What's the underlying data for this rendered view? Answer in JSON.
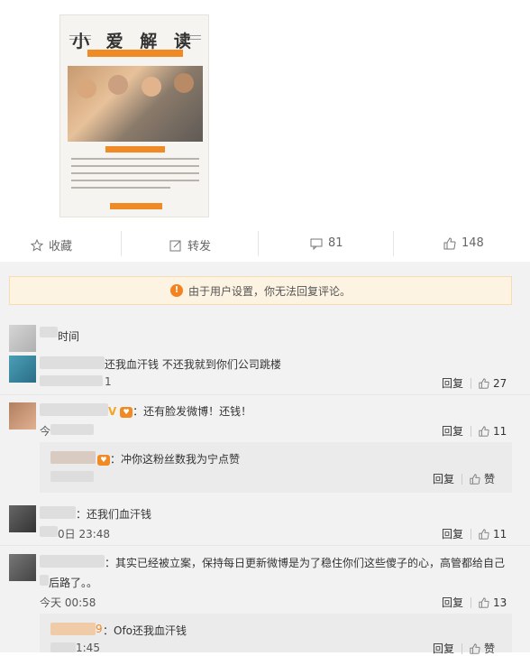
{
  "poster": {
    "title": "小 爱 解 读"
  },
  "actions": {
    "favorite": "收藏",
    "repost": "转发",
    "comments": "81",
    "likes": "148"
  },
  "notice": {
    "text": "由于用户设置，你无法回复评论。"
  },
  "comments": [
    {
      "text_partial": "时间",
      "meta": ""
    },
    {
      "text": "还我血汗钱 不还我就到你们公司跳楼",
      "meta": "1",
      "likes": "27"
    },
    {
      "text": "：还有脸发微博！还钱！",
      "meta": "今",
      "likes": "11",
      "verified": "V"
    },
    {
      "text": "：冲你这粉丝数我为宁点赞",
      "meta": "",
      "likes": "赞"
    },
    {
      "text": "：还我们血汗钱",
      "meta": "0日 23:48",
      "likes": "11"
    },
    {
      "text": "：其实已经被立案，保持每日更新微博是为了稳住你们这些傻子的心，高管都给自己",
      "text2": "后路了。。",
      "meta": "今天 00:58",
      "likes": "13"
    },
    {
      "user": "9",
      "text": "：Ofo还我血汗钱",
      "meta": "1:45",
      "likes": "赞"
    }
  ],
  "labels": {
    "reply": "回复"
  }
}
